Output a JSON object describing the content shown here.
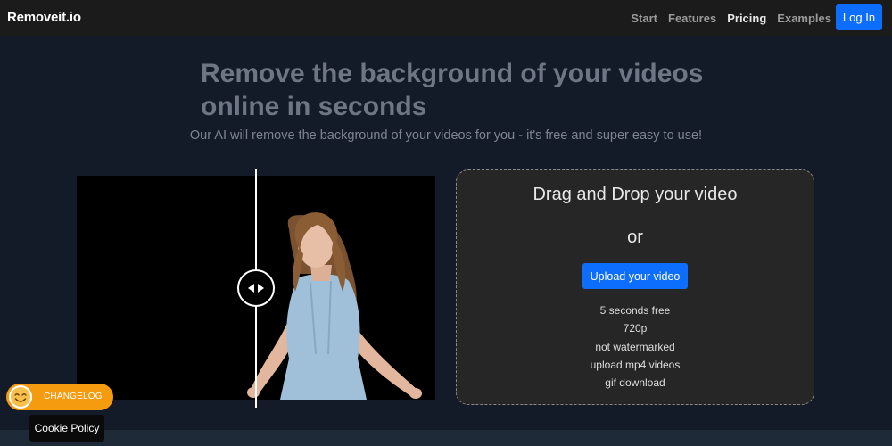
{
  "nav": {
    "brand": "Removeit.io",
    "links": [
      {
        "label": "Start"
      },
      {
        "label": "Features"
      },
      {
        "label": "Pricing"
      },
      {
        "label": "Examples"
      }
    ],
    "login_label": "Log In"
  },
  "hero": {
    "title": "Remove the background of your videos online in seconds",
    "subtitle": "Our AI will remove the background of your videos for you - it's free and super easy to use!"
  },
  "compare": {
    "handle_icon": "left-right-arrows-icon"
  },
  "dropzone": {
    "title": "Drag and Drop your video",
    "or": "or",
    "upload_label": "Upload your video",
    "features": [
      "5 seconds free",
      "720p",
      "not watermarked",
      "upload mp4 videos",
      "gif download"
    ]
  },
  "changelog": {
    "label": "CHANGELOG",
    "icon": "smiley-face-icon"
  },
  "cookie": {
    "label": "Cookie Policy"
  },
  "colors": {
    "background": "#141b28",
    "navbar": "#1b1b1b",
    "accent": "#0d6efd",
    "dropzone": "#262626",
    "changelog": "#f49b10"
  }
}
